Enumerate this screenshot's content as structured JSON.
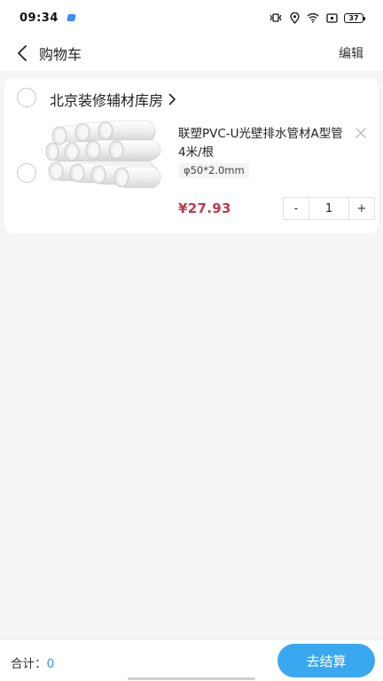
{
  "statusbar": {
    "time": "09:34",
    "battery": "37",
    "icons": [
      "vibrate-icon",
      "location-icon",
      "wifi-icon",
      "screen-icon",
      "battery-icon"
    ]
  },
  "navbar": {
    "back_icon": "chevron-left-icon",
    "title": "购物车",
    "edit_label": "编辑"
  },
  "cart": {
    "store": {
      "name": "北京装修辅材库房",
      "chevron": "chevron-right-icon"
    },
    "items": [
      {
        "name": "联塑PVC-U光壁排水管材A型管 4米/根",
        "spec": "φ50*2.0mm",
        "price": "¥27.93",
        "quantity": "1",
        "minus_label": "-",
        "plus_label": "+",
        "image": "white-pvc-pipes"
      }
    ]
  },
  "footer": {
    "total_label": "合计：",
    "total_value": "0",
    "checkout_label": "去结算"
  },
  "colors": {
    "accent": "#3aa8f0",
    "price": "#c0384e",
    "background": "#f5f5f5"
  }
}
